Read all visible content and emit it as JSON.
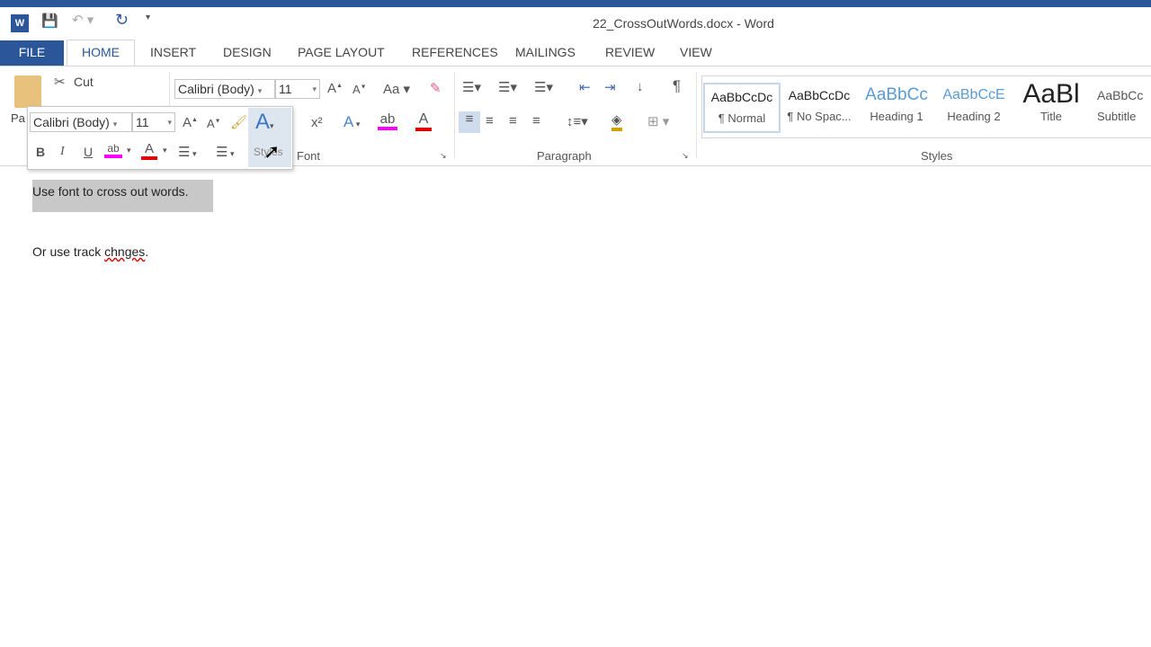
{
  "window": {
    "title": "22_CrossOutWords.docx - Word"
  },
  "tabs": [
    "FILE",
    "HOME",
    "INSERT",
    "DESIGN",
    "PAGE LAYOUT",
    "REFERENCES",
    "MAILINGS",
    "REVIEW",
    "VIEW"
  ],
  "clipboard": {
    "cut": "Cut",
    "paste": "Pa"
  },
  "font": {
    "name": "Calibri (Body)",
    "size": "11",
    "group": "Font",
    "case": "Aa"
  },
  "paragraph": {
    "group": "Paragraph"
  },
  "styles": {
    "group": "Styles",
    "items": [
      {
        "sample": "AaBbCcDc",
        "label": "¶ Normal"
      },
      {
        "sample": "AaBbCcDc",
        "label": "¶ No Spac..."
      },
      {
        "sample": "AaBbCc",
        "label": "Heading 1"
      },
      {
        "sample": "AaBbCcE",
        "label": "Heading 2"
      },
      {
        "sample": "AaBl",
        "label": "Title"
      },
      {
        "sample": "AaBbCc",
        "label": "Subtitle"
      }
    ]
  },
  "mini_toolbar": {
    "font": "Calibri (Body)",
    "size": "11",
    "styles": "Styles"
  },
  "document": {
    "line1": "Use font to cross out words.",
    "line2_prefix": "Or use track ",
    "line2_misspelled": "chnges",
    "line2_suffix": "."
  },
  "colors": {
    "accent": "#2b579a",
    "highlight": "#ff00ff",
    "font_color": "#e00000"
  }
}
